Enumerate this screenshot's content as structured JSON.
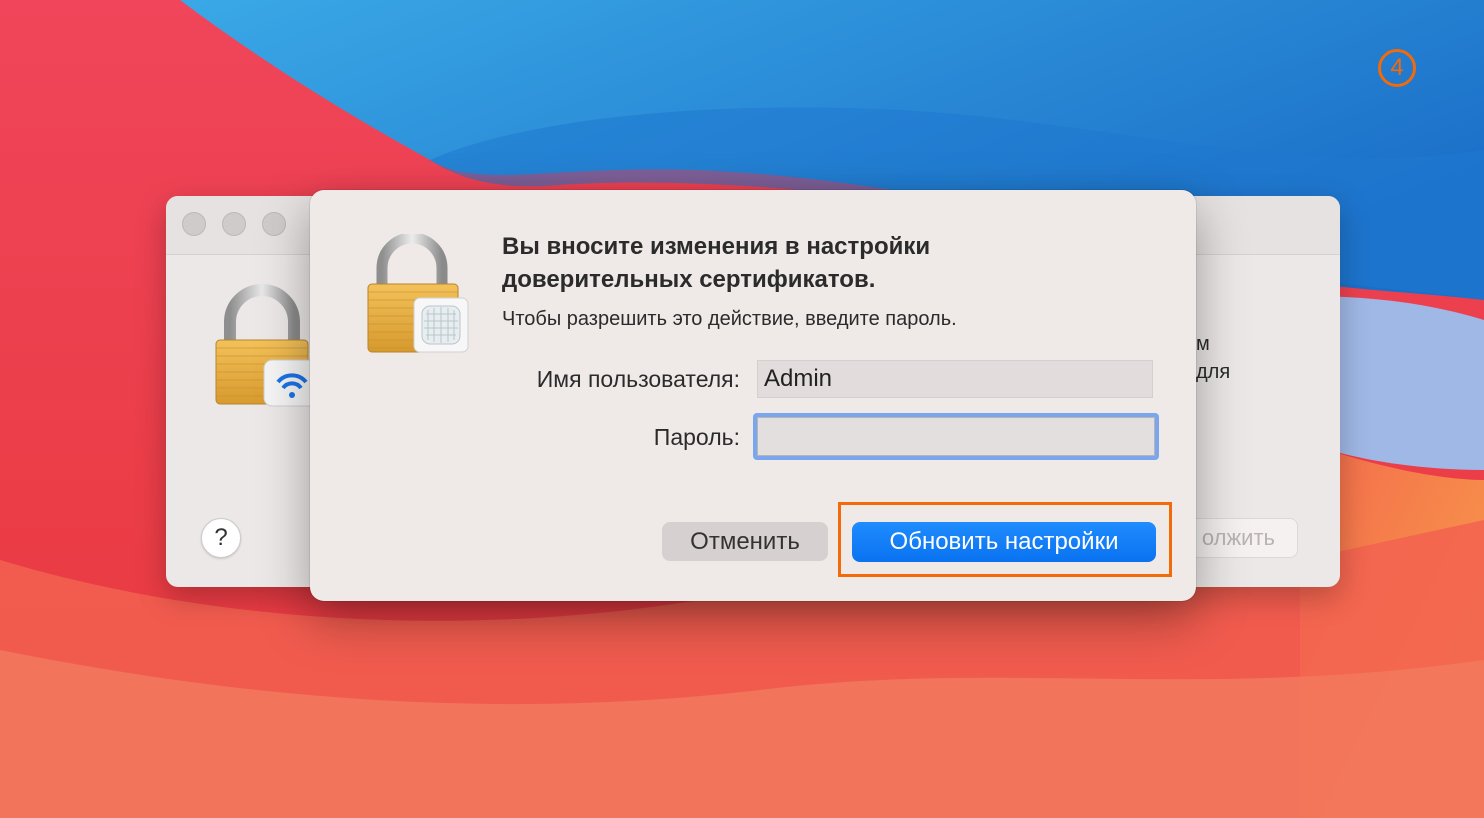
{
  "step_badge": "4",
  "colors": {
    "accent_orange": "#f26a0a",
    "primary_blue": "#0a72f0",
    "focus_ring": "#7aa6ee"
  },
  "back_window": {
    "text_line1": "м",
    "text_line2": "для",
    "help_label": "?",
    "continue_label": "олжить",
    "icon": "lock-wifi-icon"
  },
  "dialog": {
    "icon": "lock-certificate-icon",
    "title": "Вы вносите изменения в настройки доверительных сертификатов.",
    "message": "Чтобы разрешить это действие, введите пароль.",
    "username_label": "Имя пользователя:",
    "username_value": "Admin",
    "password_label": "Пароль:",
    "password_value": "",
    "cancel_label": "Отменить",
    "update_label": "Обновить настройки"
  }
}
